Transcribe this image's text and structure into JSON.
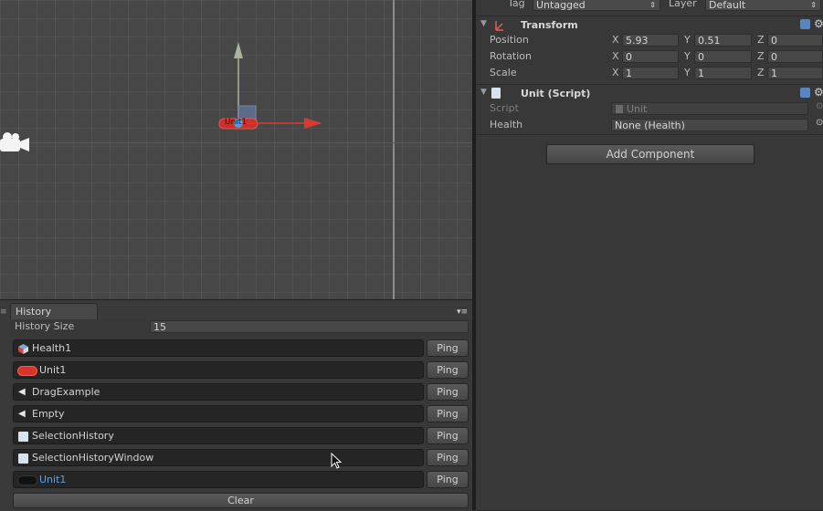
{
  "inspector": {
    "tag_label": "Tag",
    "tag_value": "Untagged",
    "layer_label": "Layer",
    "layer_value": "Default",
    "transform": {
      "title": "Transform",
      "position_label": "Position",
      "rotation_label": "Rotation",
      "scale_label": "Scale",
      "axis_x": "X",
      "axis_y": "Y",
      "axis_z": "Z",
      "position": [
        "5.93",
        "0.51",
        "0"
      ],
      "rotation": [
        "0",
        "0",
        "0"
      ],
      "scale": [
        "1",
        "1",
        "1"
      ]
    },
    "unit_script": {
      "title": "Unit (Script)",
      "script_label": "Script",
      "script_value": "Unit",
      "health_label": "Health",
      "health_value": "None (Health)"
    },
    "add_component_label": "Add Component"
  },
  "scene": {
    "object_label": "Unit1"
  },
  "history": {
    "tab_label": "History",
    "size_label": "History Size",
    "size_value": "15",
    "ping_label": "Ping",
    "clear_label": "Clear",
    "items": [
      {
        "label": "Health1",
        "icon": "cube-icon"
      },
      {
        "label": "Unit1",
        "icon": "capsule-icon"
      },
      {
        "label": "DragExample",
        "icon": "unity-scene-icon"
      },
      {
        "label": "Empty",
        "icon": "unity-scene-icon"
      },
      {
        "label": "SelectionHistory",
        "icon": "script-icon"
      },
      {
        "label": "SelectionHistoryWindow",
        "icon": "script-icon"
      },
      {
        "label": "Unit1",
        "icon": "capsule-icon",
        "selected": true
      }
    ]
  },
  "colors": {
    "scene_bg": "#474747",
    "panel_bg": "#383838",
    "selected_text": "#5aa0e8",
    "x_handle": "#d83a2e",
    "y_handle": "#a9b49a"
  }
}
